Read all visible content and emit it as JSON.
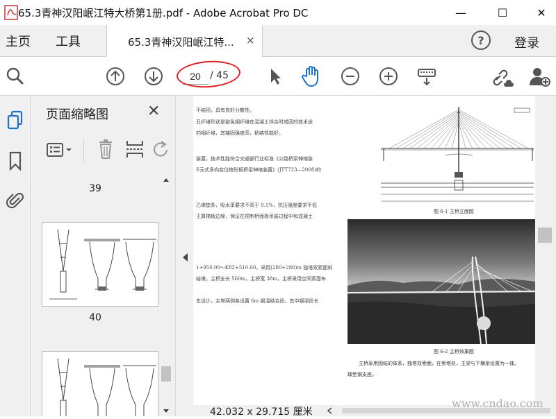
{
  "window": {
    "title": "65.3青神汉阳岷江特大桥第1册.pdf - Adobe Acrobat Pro DC",
    "minimize": "—",
    "maximize": "☐",
    "close": "✕"
  },
  "tabs": {
    "home": "主页",
    "tools": "工具",
    "document": "65.3青神汉阳岷江特...",
    "document_close": "×",
    "help": "?",
    "login": "登录"
  },
  "toolbar": {
    "icons": [
      "zoom-search-icon",
      "page-up-icon",
      "page-down-icon",
      "select-arrow-icon",
      "hand-tool-icon",
      "zoom-out-icon",
      "zoom-in-icon",
      "keyboard-scroll-icon",
      "share-link-icon",
      "add-user-icon"
    ],
    "current_page": "20",
    "total_pages": "/ 45",
    "accent_color": "#1a73c9"
  },
  "thumbnails": {
    "title": "页面缩略图",
    "close": "✕",
    "pages": [
      "39",
      "40"
    ]
  },
  "document": {
    "lines": [
      "不结团，具有良好分散性。",
      "丑纤维形状是避免钢纤维在混凝土拌合时成团的技术途",
      "钓钢纤维，其锚固强度高，粘结性能好。",
      "装置，技术性能符合交通部行业标准《公路桥梁伸缩装",
      "E元式多向变位梳形板桥梁伸缩装置》(JTT723—2008)的",
      "乙烯垫条，吸水率要求不高于 0.1%，抗压强度要求不低",
      "王算梯板边缘，保证在预制桥面板吊装过程中和混凝土",
      "1+950.00～K82+510.00，采用(280+280)m 独塔双索面斜",
      "结墩。主桥全长 560m，主桥宽 38m，主桥采用空间索面布",
      "玄设计，主塔两侧各设置 6m 钢混结合段，其中钢梁段长"
    ],
    "caption1": "图 6-1  主桥立面图",
    "caption2": "图 6-2  主桥效果图",
    "para1": "主桥采用固结的体系，独塔双索面，在索塔处，主梁与下横梁设置为一体。",
    "para2": "球型钢支座。"
  },
  "status": {
    "page_size": "42.032 x 29.715 厘米"
  },
  "watermark": "www.cndao.com"
}
